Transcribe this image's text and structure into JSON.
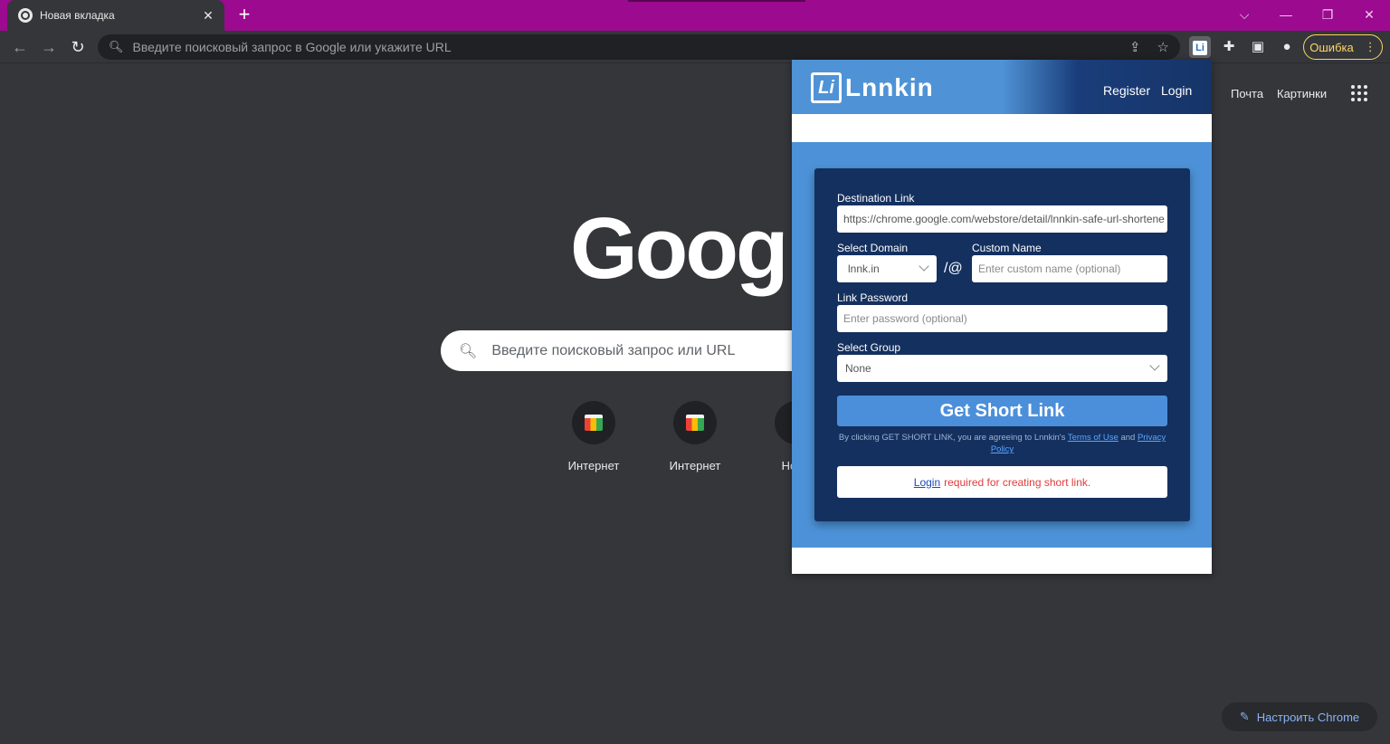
{
  "browser": {
    "tab_title": "Новая вкладка",
    "tab_close": "✕",
    "new_tab": "+",
    "omnibox_placeholder": "Введите поисковый запрос в Google или укажите URL",
    "error_label": "Ошибка",
    "accent_color": "#9c0a8f"
  },
  "ntp": {
    "links": {
      "mail": "Почта",
      "images": "Картинки"
    },
    "logo": "Google",
    "search_placeholder": "Введите поисковый запрос или URL",
    "tiles": [
      {
        "label": "Интернет"
      },
      {
        "label": "Интернет"
      },
      {
        "label": "Новы"
      }
    ],
    "customize_label": "Настроить Chrome"
  },
  "popup": {
    "logo_text": "Lnnkin",
    "logo_mark": "Li",
    "register": "Register",
    "login": "Login",
    "destination_label": "Destination Link",
    "destination_value": "https://chrome.google.com/webstore/detail/lnnkin-safe-url-shortene",
    "domain_label": "Select Domain",
    "domain_value": "lnnk.in",
    "separator": "/@",
    "custom_name_label": "Custom Name",
    "custom_name_placeholder": "Enter custom name (optional)",
    "password_label": "Link Password",
    "password_placeholder": "Enter password (optional)",
    "group_label": "Select Group",
    "group_value": "None",
    "submit_label": "Get Short Link",
    "terms_prefix": "By clicking GET SHORT LINK, you are agreeing to Lnnkin's",
    "terms_link": "Terms of Use",
    "terms_and": "and",
    "privacy_link": "Privacy Policy",
    "login_link": "Login",
    "login_message": "required for creating short link."
  }
}
